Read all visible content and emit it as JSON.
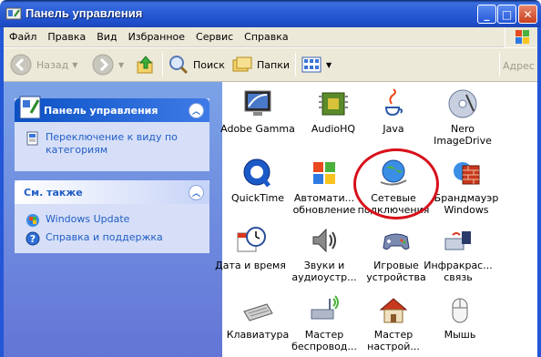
{
  "window": {
    "title": "Панель управления",
    "min_label": "_",
    "max_label": "□",
    "close_label": "✕"
  },
  "menu": {
    "items": [
      {
        "label": "Файл",
        "key": "file"
      },
      {
        "label": "Правка",
        "key": "edit"
      },
      {
        "label": "Вид",
        "key": "view"
      },
      {
        "label": "Избранное",
        "key": "favorites"
      },
      {
        "label": "Сервис",
        "key": "tools"
      },
      {
        "label": "Справка",
        "key": "help"
      }
    ]
  },
  "toolbar": {
    "back_label": "Назад",
    "search_label": "Поиск",
    "folders_label": "Папки",
    "address_label": "Адрес"
  },
  "sidebar": {
    "panel1": {
      "title": "Панель управления",
      "collapse": "︿",
      "links": [
        {
          "label": "Переключение к виду по категориям",
          "icon": "category-view-icon"
        }
      ]
    },
    "panel2": {
      "title": "См. также",
      "collapse": "︿",
      "links": [
        {
          "label": "Windows Update",
          "icon": "windows-update-icon"
        },
        {
          "label": "Справка и поддержка",
          "icon": "help-icon"
        }
      ]
    }
  },
  "items": [
    {
      "label": "Adobe Gamma",
      "icon": "monitor-gamma-icon"
    },
    {
      "label": "AudioHQ",
      "icon": "chip-icon"
    },
    {
      "label": "Java",
      "icon": "java-icon"
    },
    {
      "label": "Nero ImageDrive",
      "icon": "disc-icon"
    },
    {
      "label": "QuickTime",
      "icon": "quicktime-icon"
    },
    {
      "label": "Автомати... обновление",
      "icon": "windows-flag-icon"
    },
    {
      "label": "Сетевые подключения",
      "icon": "network-globe-icon"
    },
    {
      "label": "Брандмауэр Windows",
      "icon": "firewall-icon"
    },
    {
      "label": "Дата и время",
      "icon": "clock-calendar-icon"
    },
    {
      "label": "Звуки и аудиоустр...",
      "icon": "speaker-icon"
    },
    {
      "label": "Игровые устройства",
      "icon": "gamepad-icon"
    },
    {
      "label": "Инфракрас... связь",
      "icon": "infrared-icon"
    },
    {
      "label": "Клавиатура",
      "icon": "keyboard-icon"
    },
    {
      "label": "Мастер беспровод...",
      "icon": "wireless-icon"
    },
    {
      "label": "Мастер настрой...",
      "icon": "house-network-icon"
    },
    {
      "label": "Мышь",
      "icon": "mouse-icon"
    }
  ],
  "colors": {
    "titlebar": "#2c5fd6",
    "sidebar_bg": "#7ba2e7",
    "link": "#215dc6",
    "highlight_circle": "#d8101a"
  }
}
